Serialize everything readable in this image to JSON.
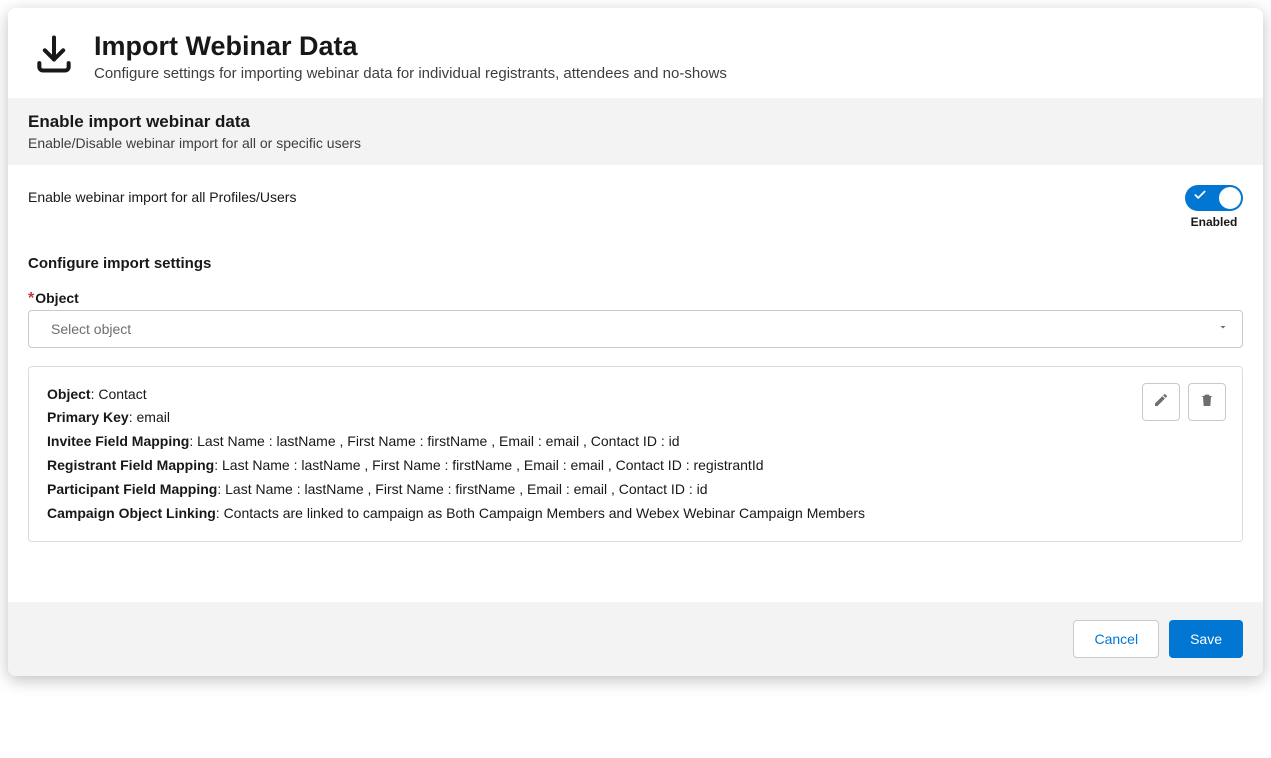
{
  "header": {
    "title": "Import Webinar Data",
    "subtitle": "Configure settings for importing webinar data for individual registrants, attendees and no-shows"
  },
  "section": {
    "title": "Enable import webinar data",
    "subtitle": "Enable/Disable webinar import for all or specific users"
  },
  "enable": {
    "label": "Enable webinar import for all Profiles/Users",
    "state_label": "Enabled",
    "value": true
  },
  "configure": {
    "heading": "Configure import settings",
    "object_label": "Object",
    "select_placeholder": "Select object"
  },
  "card": {
    "rows": [
      {
        "label": "Object",
        "value": "Contact"
      },
      {
        "label": "Primary Key",
        "value": "email"
      },
      {
        "label": "Invitee Field Mapping",
        "value": "Last Name : lastName , First Name : firstName , Email : email , Contact ID : id"
      },
      {
        "label": "Registrant Field Mapping",
        "value": "Last Name : lastName , First Name : firstName , Email : email , Contact ID : registrantId"
      },
      {
        "label": "Participant Field Mapping",
        "value": "Last Name : lastName , First Name : firstName , Email : email , Contact ID : id"
      },
      {
        "label": "Campaign Object Linking",
        "value": "Contacts are linked to campaign as Both Campaign Members and Webex Webinar Campaign Members"
      }
    ]
  },
  "footer": {
    "cancel": "Cancel",
    "save": "Save"
  }
}
